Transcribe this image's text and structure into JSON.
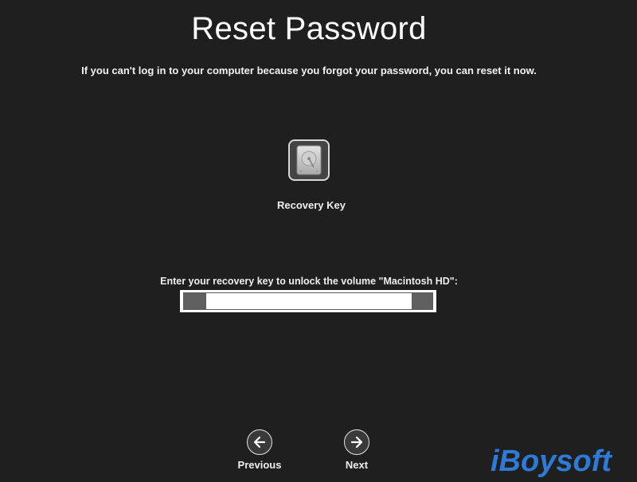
{
  "page": {
    "title": "Reset Password",
    "subtitle": "If you can't log in to your computer because you forgot your password, you can reset it now."
  },
  "recovery": {
    "icon": "internal-disk-icon",
    "label": "Recovery Key"
  },
  "key_field": {
    "label": "Enter your recovery key to unlock the volume \"Macintosh HD\":",
    "value": "",
    "placeholder": ""
  },
  "nav": {
    "previous_label": "Previous",
    "previous_icon": "arrow-left-icon",
    "next_label": "Next",
    "next_icon": "arrow-right-icon"
  },
  "watermark": {
    "text": "iBoysoft",
    "color": "#2d7bd6"
  },
  "colors": {
    "background": "#1f1f1f",
    "text": "#ffffff"
  }
}
